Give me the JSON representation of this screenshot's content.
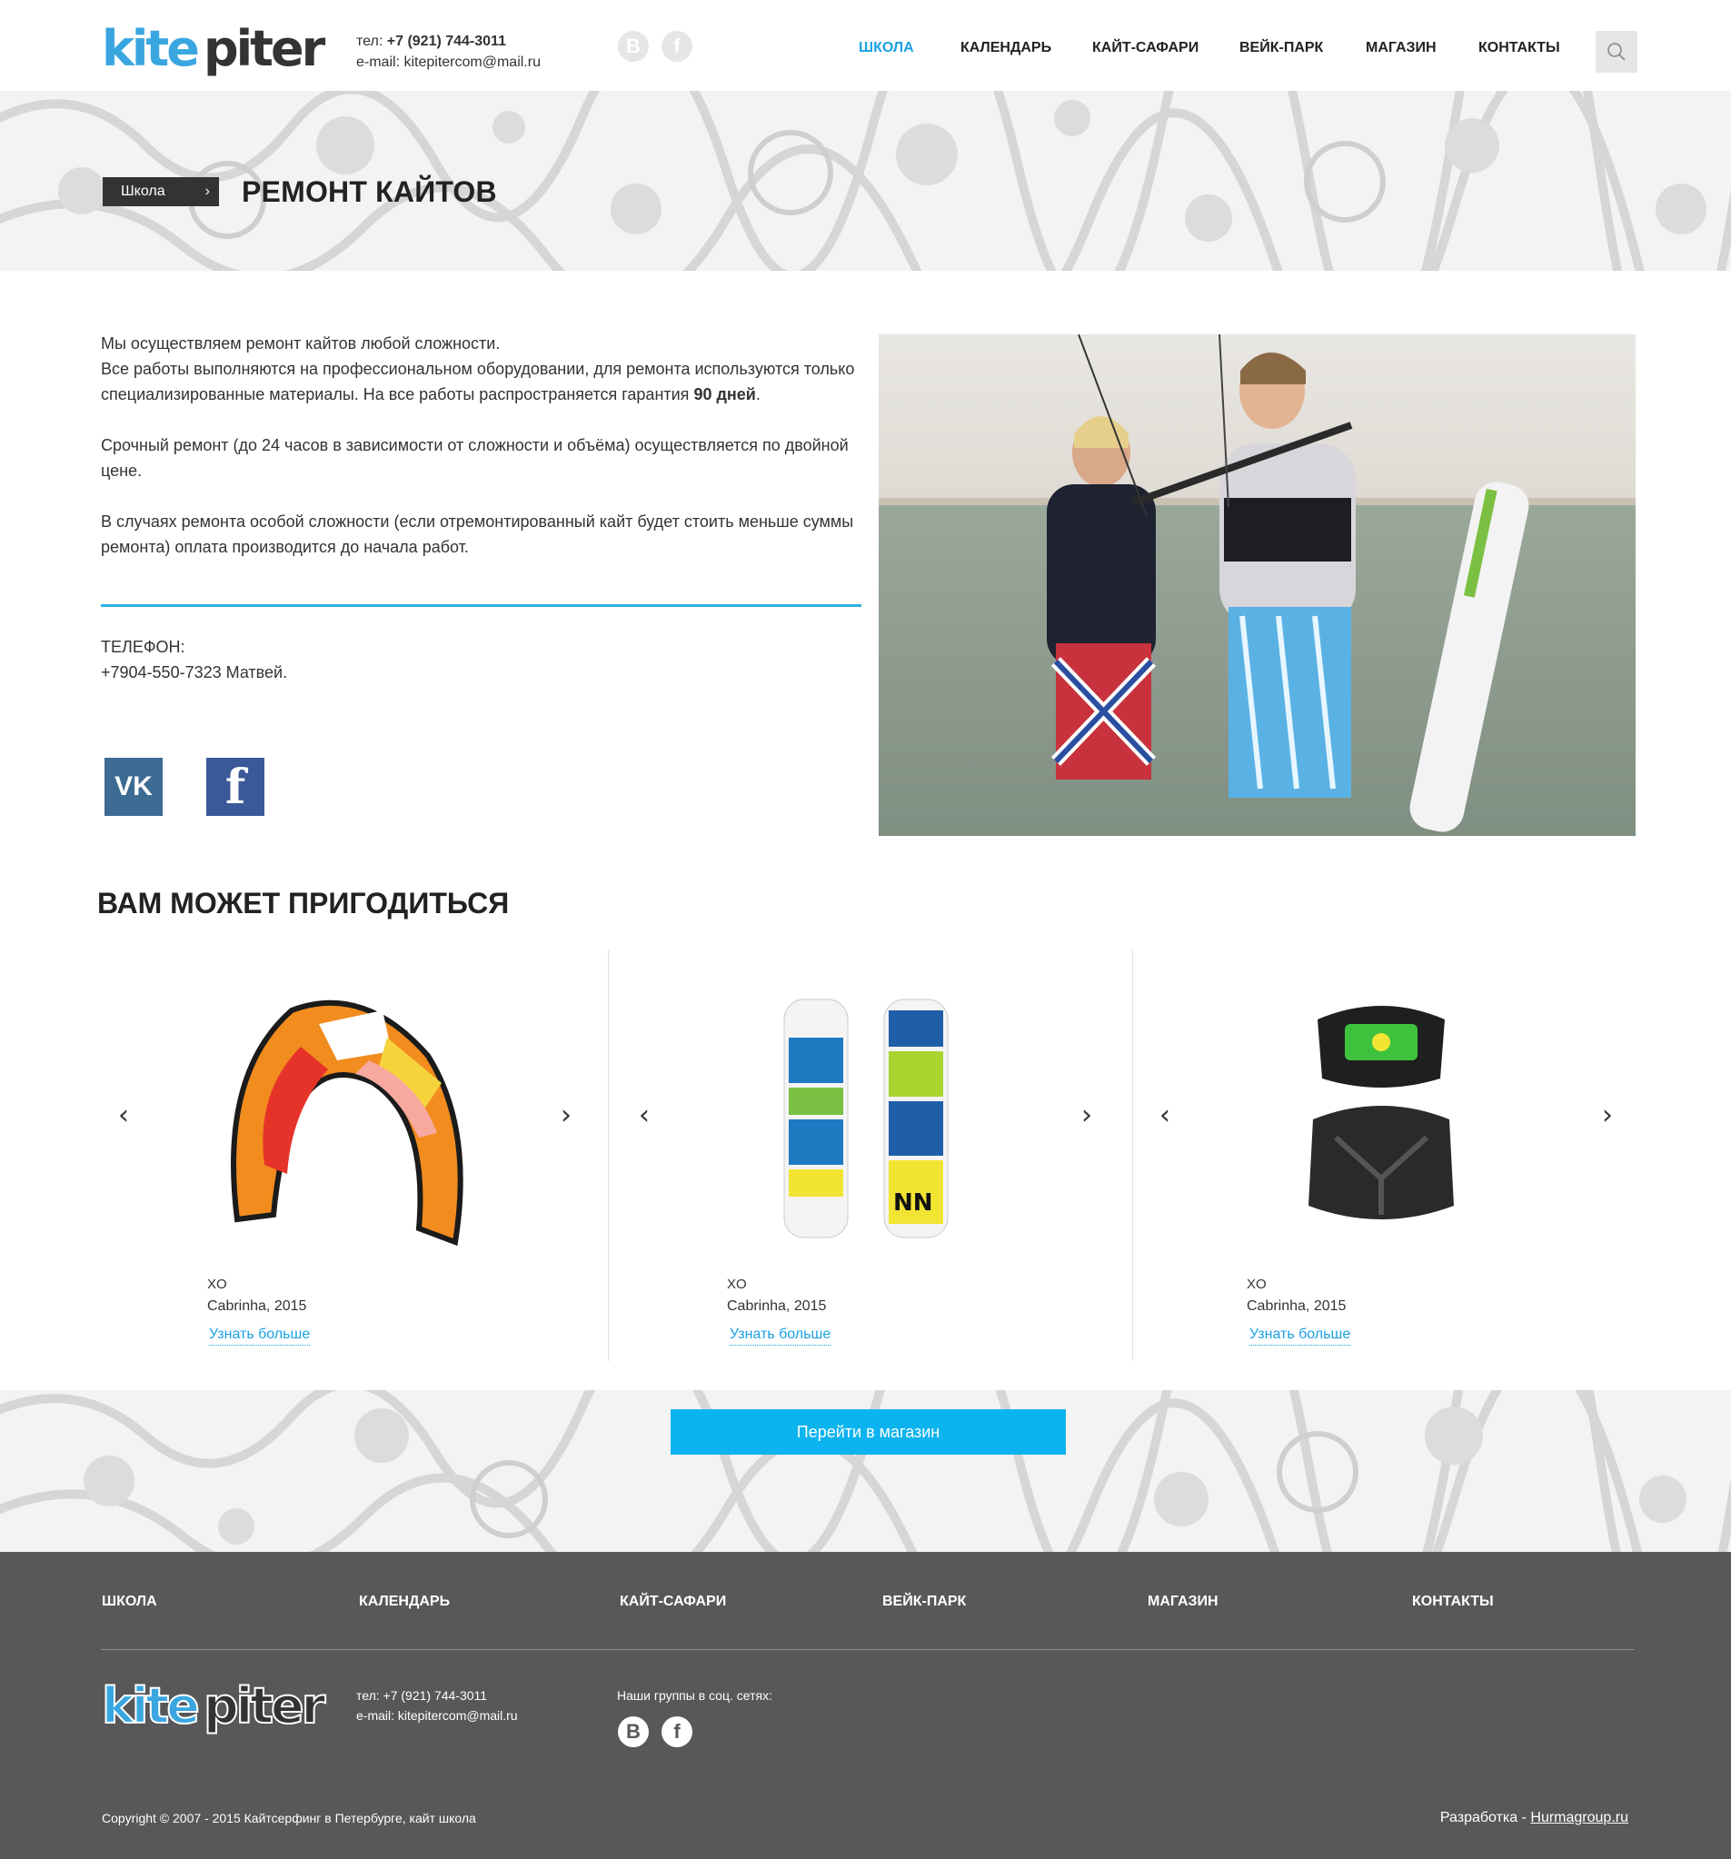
{
  "header": {
    "logo_alt": "kitepiter",
    "phone_label": "тел:",
    "phone": "+7 (921) 744-3011",
    "email_label": "e-mail:",
    "email": "kitepitercom@mail.ru",
    "social": [
      "В",
      "f"
    ],
    "nav": [
      "ШКОЛА",
      "КАЛЕНДАРЬ",
      "КАЙТ-САФАРИ",
      "ВЕЙК-ПАРК",
      "МАГАЗИН",
      "КОНТАКТЫ"
    ],
    "active_nav": "ШКОЛА"
  },
  "banner": {
    "breadcrumb": "Школа",
    "title": "РЕМОНТ КАЙТОВ"
  },
  "content": {
    "p1_line1": "Мы осуществляем ремонт кайтов любой сложности.",
    "p1_line2": "Все работы выполняются на профессиональном оборудовании, для ремонта используются только специализированные материалы. На все работы распространяется гарантия ",
    "p1_bold": "90 дней",
    "p1_end": ".",
    "p2": "Срочный ремонт (до 24 часов в зависимости от сложности и объёма) осуществляется по двойной цене.",
    "p3": "В случаях ремонта особой сложности (если отремонтированный кайт будет стоить меньше суммы ремонта) оплата производится до начала работ.",
    "phone_label": "ТЕЛЕФОН:",
    "phone_value": "+7904-550-7323 Матвей."
  },
  "related": {
    "title": "ВАМ МОЖЕТ ПРИГОДИТЬСЯ",
    "products": [
      {
        "name": "XO",
        "brand": "Cabrinha, 2015",
        "link": "Узнать больше",
        "image": "kite-image"
      },
      {
        "name": "XO",
        "brand": "Cabrinha, 2015",
        "link": "Узнать больше",
        "image": "board-image"
      },
      {
        "name": "XO",
        "brand": "Cabrinha, 2015",
        "link": "Узнать больше",
        "image": "harness-image"
      }
    ],
    "shop_button": "Перейти в магазин"
  },
  "footer": {
    "nav": [
      "ШКОЛА",
      "КАЛЕНДАРЬ",
      "КАЙТ-САФАРИ",
      "ВЕЙК-ПАРК",
      "МАГАЗИН",
      "КОНТАКТЫ"
    ],
    "phone_line": "тел: +7 (921) 744-3011",
    "email_line": "e-mail: kitepitercom@mail.ru",
    "social_label": "Наши группы в соц. сетях:",
    "social": [
      "В",
      "f"
    ],
    "copyright": "Copyright © 2007 - 2015 Кайтсерфинг в Петербурге, кайт школа",
    "dev_label": "Разработка - ",
    "dev_link": "Hurmagroup.ru"
  },
  "colors": {
    "accent": "#1ba1e2",
    "button": "#0bb3ef",
    "footer_bg": "#58585a",
    "divider": "#2eb3e4"
  }
}
